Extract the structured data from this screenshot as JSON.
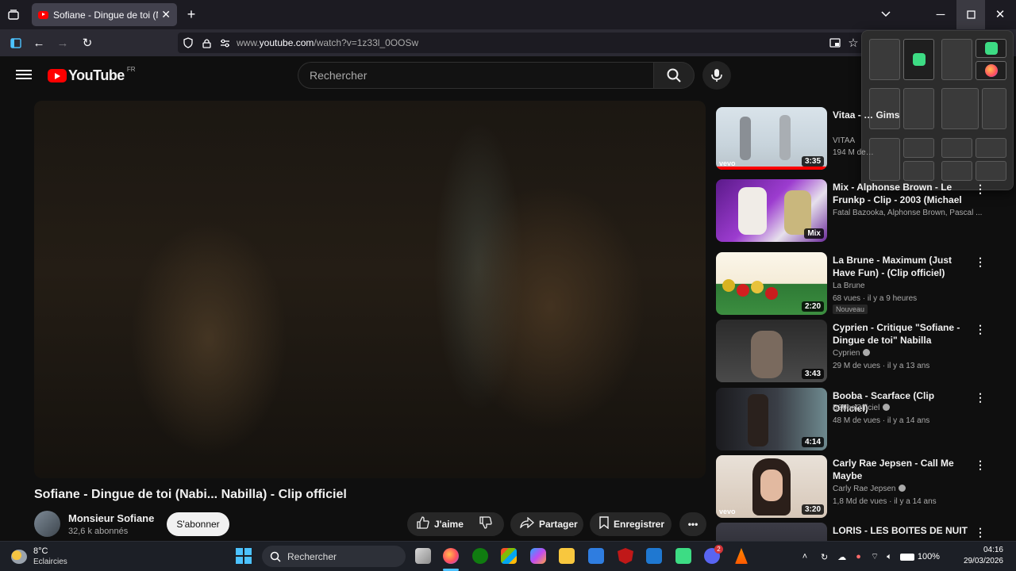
{
  "browser": {
    "tab_title": "Sofiane - Dingue de toi (Nabi...",
    "url_prefix": "www.",
    "url_domain": "youtube.com",
    "url_path": "/watch?v=1z33l_0OOSw"
  },
  "masthead": {
    "logo_text": "YouTube",
    "country": "FR",
    "search_placeholder": "Rechercher"
  },
  "video": {
    "title": "Sofiane - Dingue de toi (Nabi... Nabilla) - Clip officiel",
    "channel": "Monsieur Sofiane",
    "subscribers": "32,6 k abonnés",
    "subscribe_label": "S'abonner",
    "like_label": "J'aime",
    "share_label": "Partager",
    "save_label": "Enregistrer"
  },
  "recommendations": [
    {
      "title": "Vitaa - … Gims",
      "channel": "VITAA",
      "meta": "194 M de…",
      "duration": "3:35",
      "vevo": "vevo"
    },
    {
      "title": "Mix - Alphonse Brown - Le Frunkp - Clip - 2003 (Michael ...",
      "channel": "Fatal Bazooka, Alphonse Brown, Pascal ...",
      "meta": "",
      "duration": "Mix"
    },
    {
      "title": "La Brune - Maximum (Just Have Fun) - (Clip officiel)",
      "channel": "La Brune",
      "meta": "68 vues · il y a 9 heures",
      "badge": "Nouveau",
      "duration": "2:20"
    },
    {
      "title": "Cyprien - Critique \"Sofiane - Dingue de toi\" Nabilla",
      "channel": "Cyprien",
      "meta": "29 M de vues · il y a 13 ans",
      "duration": "3:43"
    },
    {
      "title": "Booba - Scarface (Clip Officiel)",
      "channel": "B20baOfficiel",
      "meta": "48 M de vues · il y a 14 ans",
      "duration": "4:14"
    },
    {
      "title": "Carly Rae Jepsen - Call Me Maybe",
      "channel": "Carly Rae Jepsen",
      "meta": "1,8 Md de vues · il y a 14 ans",
      "duration": "3:20",
      "vevo": "vevo"
    },
    {
      "title": "LORIS - LES BOITES DE NUIT",
      "channel": "",
      "meta": "",
      "duration": ""
    }
  ],
  "taskbar": {
    "temperature": "8°C",
    "weather": "Eclaircies",
    "search_label": "Rechercher",
    "battery": "100%",
    "time": "04:16",
    "date": "29/03/2026",
    "discord_badge": "2"
  },
  "colors": {
    "brand_red": "#ff0000",
    "accent_blue": "#4cc2ff"
  }
}
